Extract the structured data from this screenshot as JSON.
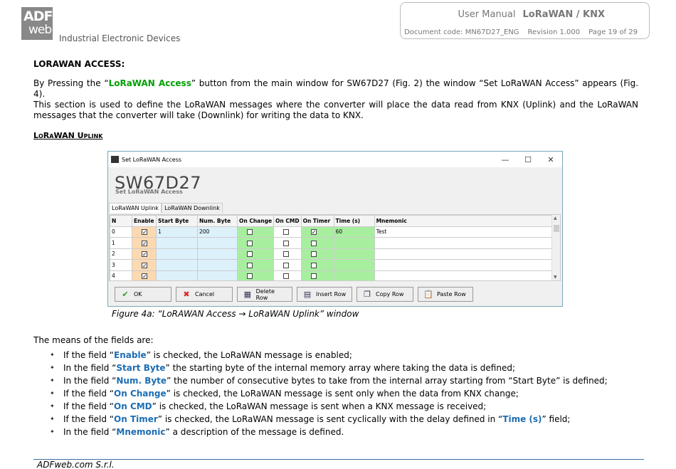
{
  "header": {
    "logo_line1": "ADF",
    "logo_line2": "web",
    "company": "Industrial Electronic Devices",
    "manual": "User Manual",
    "product": "LoRaWAN / KNX",
    "doc_code": "Document code: MN67D27_ENG",
    "revision": "Revision 1.000",
    "page": "Page 19 of 29"
  },
  "section_title": "LORAWAN ACCESS:",
  "para1": {
    "pre": "By Pressing the “",
    "link": "LoRaWAN Access",
    "post": "” button from the main window for SW67D27 (Fig. 2) the window “Set LoRaWAN Access” appears (Fig. 4)."
  },
  "para2": "This section is used to define the LoRaWAN messages where the converter will place the data read from KNX (Uplink) and the LoRaWAN messages that the converter will take (Downlink) for writing the data to KNX.",
  "subsection_title": "LoRaWAN Uplink",
  "window": {
    "title": "Set LoRaWAN Access",
    "device": "SW67D27",
    "device_sub": "Set LoRaWAN Access",
    "tabs": [
      "LoRaWAN Uplink",
      "LoRaWAN Downlink"
    ],
    "columns": [
      "N",
      "Enable",
      "Start Byte",
      "Num. Byte",
      "On Change",
      "On CMD",
      "On Timer",
      "Time (s)",
      "Mnemonic"
    ],
    "rows": [
      {
        "n": "0",
        "enable": true,
        "start": "1",
        "num": "200",
        "change": false,
        "cmd": false,
        "timer": true,
        "time": "60",
        "mnemonic": "Test"
      },
      {
        "n": "1",
        "enable": true,
        "start": "",
        "num": "",
        "change": false,
        "cmd": false,
        "timer": false,
        "time": "",
        "mnemonic": ""
      },
      {
        "n": "2",
        "enable": true,
        "start": "",
        "num": "",
        "change": false,
        "cmd": false,
        "timer": false,
        "time": "",
        "mnemonic": ""
      },
      {
        "n": "3",
        "enable": true,
        "start": "",
        "num": "",
        "change": false,
        "cmd": false,
        "timer": false,
        "time": "",
        "mnemonic": ""
      },
      {
        "n": "4",
        "enable": true,
        "start": "",
        "num": "",
        "change": false,
        "cmd": false,
        "timer": false,
        "time": "",
        "mnemonic": ""
      }
    ],
    "buttons": [
      {
        "label": "OK",
        "icon": "check-icon",
        "glyph": "✔",
        "color": "#2a9d2a"
      },
      {
        "label": "Cancel",
        "icon": "cancel-icon",
        "glyph": "✖",
        "color": "#d22"
      },
      {
        "label": "Delete Row",
        "icon": "delete-row-icon",
        "glyph": "▦",
        "color": "#335"
      },
      {
        "label": "Insert Row",
        "icon": "insert-row-icon",
        "glyph": "▤",
        "color": "#335"
      },
      {
        "label": "Copy Row",
        "icon": "copy-row-icon",
        "glyph": "❐",
        "color": "#335"
      },
      {
        "label": "Paste Row",
        "icon": "paste-row-icon",
        "glyph": "📋",
        "color": "#8a5a20"
      }
    ]
  },
  "caption": "Figure 4a: “LoRAWAN Access → LoRaWAN Uplink” window",
  "means": "The means of the fields are:",
  "bullets": [
    {
      "pre": "If the field “",
      "kw": "Enable",
      "post": "” is checked, the LoRaWAN message is enabled;"
    },
    {
      "pre": "In the field “",
      "kw": "Start Byte",
      "post": "” the starting byte of the internal memory array where taking the data is defined;"
    },
    {
      "pre": "In the field “",
      "kw": "Num. Byte",
      "post": "” the number of consecutive bytes to take from the internal array starting from “Start Byte” is defined;"
    },
    {
      "pre": "If the field “",
      "kw": "On Change",
      "post": "” is checked, the LoRaWAN message is sent only when the data from KNX change;"
    },
    {
      "pre": "If the field “",
      "kw": "On CMD",
      "post": "” is checked, the LoRaWAN message is sent when a KNX message is received;"
    },
    {
      "pre": "If the field “",
      "kw": "On Timer",
      "post": "” is checked, the LoRaWAN message is sent cyclically with the delay defined in “",
      "kw2": "Time (s)",
      "post2": "” field;"
    },
    {
      "pre": "In the field “",
      "kw": "Mnemonic",
      "post": "” a description of the message is defined."
    }
  ],
  "footer": "ADFweb.com S.r.l."
}
